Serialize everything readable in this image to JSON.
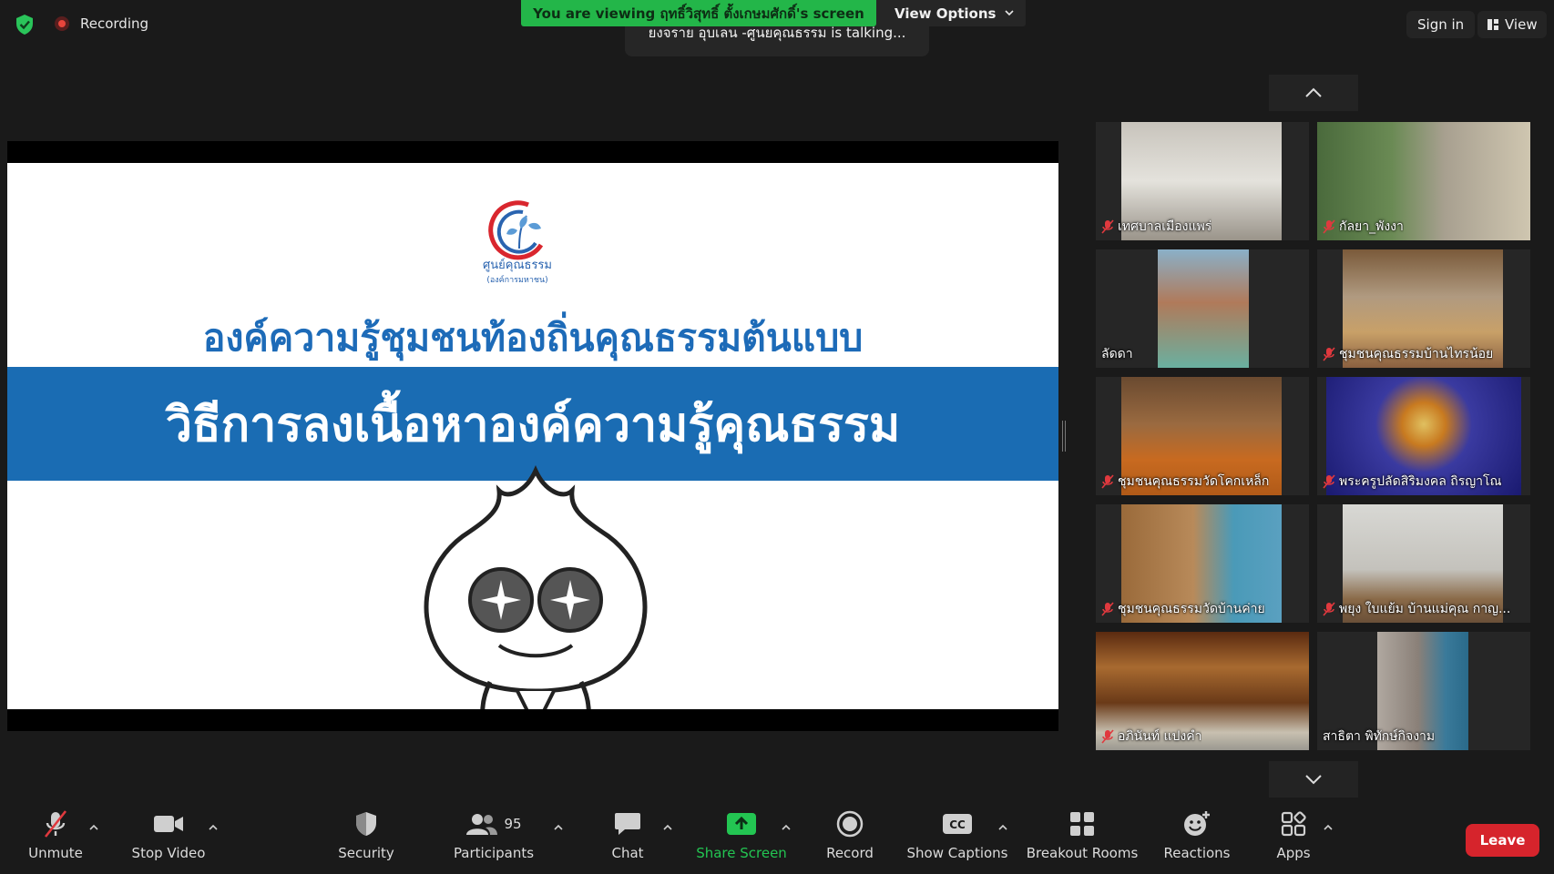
{
  "topbar": {
    "recording_label": "Recording",
    "viewing_banner": "You are viewing ฤทธิ์วิสุทธิ์ ตั้งเกษมศักดิ์'s screen",
    "view_options_label": "View Options",
    "talking_text": "ยงจราย อุบเลน -ศูนยคุณธรรม is talking...",
    "sign_in_label": "Sign in",
    "view_label": "View"
  },
  "slide": {
    "logo_text_line1": "ศูนย์คุณธรรม",
    "logo_text_line2": "(องค์การมหาชน)",
    "title": "องค์ความรู้ชุมชนท้องถิ่นคุณธรรมต้นแบบ",
    "banner": "วิธีการลงเนื้อหาองค์ความรู้คุณธรรม",
    "colors": {
      "title_blue": "#1d6bb8",
      "band_blue": "#1a6cb3"
    }
  },
  "gallery": {
    "participants": [
      {
        "name": "เทศบาลเมืองแพร่",
        "muted": true
      },
      {
        "name": "กัลยา_พังงา",
        "muted": true
      },
      {
        "name": "ลัดดา",
        "muted": false
      },
      {
        "name": "ชุมชนคุณธรรมบ้านไทรน้อย",
        "muted": true
      },
      {
        "name": "ชุมชนคุณธรรมวัดโคกเหล็ก",
        "muted": true
      },
      {
        "name": "พระครูปลัดสิริมงคล ถิรญาโณ",
        "muted": true
      },
      {
        "name": "ชุมชนคุณธรรมวัดบ้านค่าย",
        "muted": true
      },
      {
        "name": "พยุง ใบแย้ม บ้านแม่คุณ กาญ...",
        "muted": true
      },
      {
        "name": "อภินันท์ แปงคำ",
        "muted": true
      },
      {
        "name": "สาธิตา พิทักษ์กิจงาม",
        "muted": false
      }
    ]
  },
  "toolbar": {
    "unmute": "Unmute",
    "stop_video": "Stop Video",
    "security": "Security",
    "participants": "Participants",
    "participants_count": "95",
    "chat": "Chat",
    "share_screen": "Share Screen",
    "record": "Record",
    "show_captions": "Show Captions",
    "breakout_rooms": "Breakout Rooms",
    "reactions": "Reactions",
    "apps": "Apps",
    "leave": "Leave",
    "colors": {
      "share_green": "#23c552",
      "leave_red": "#d6242c",
      "muted_red": "#e0393e"
    }
  }
}
